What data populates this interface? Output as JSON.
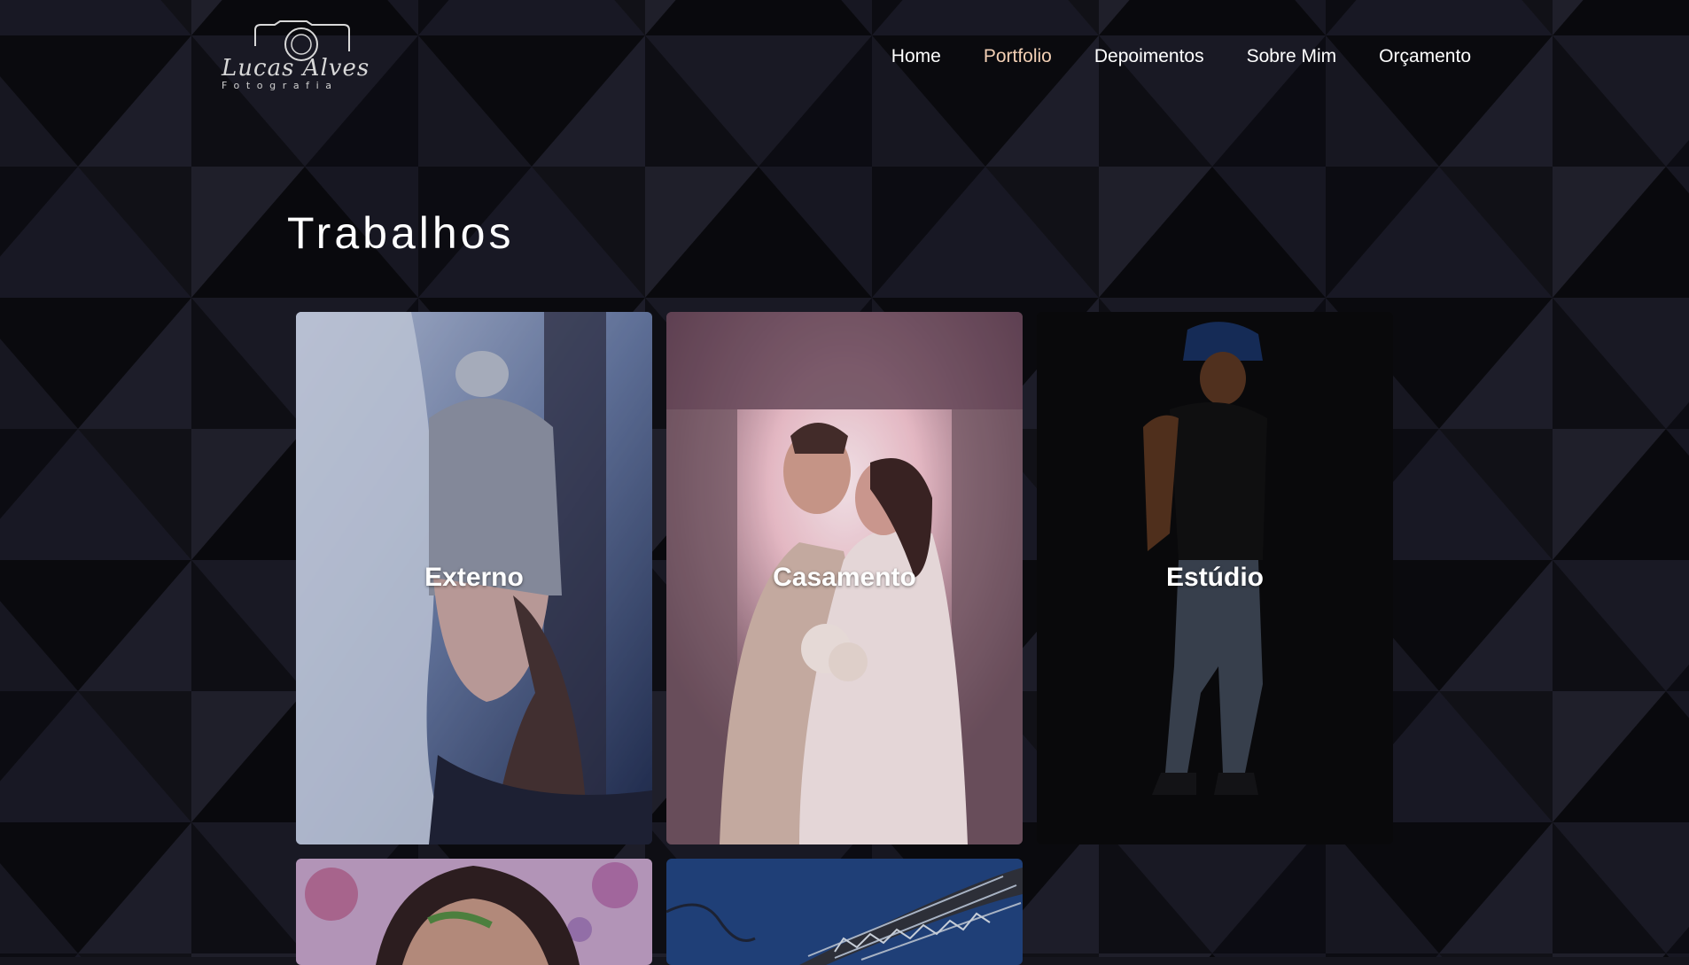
{
  "brand": {
    "logo_script": "Lucas Alves",
    "logo_sub": "Fotografia"
  },
  "nav": {
    "items": [
      {
        "label": "Home",
        "active": false
      },
      {
        "label": "Portfolio",
        "active": true
      },
      {
        "label": "Depoimentos",
        "active": false
      },
      {
        "label": "Sobre Mim",
        "active": false
      },
      {
        "label": "Orçamento",
        "active": false
      }
    ]
  },
  "section": {
    "title": "Trabalhos"
  },
  "portfolio": {
    "cards": [
      {
        "label": "Externo",
        "icon": "winter-portrait-photo"
      },
      {
        "label": "Casamento",
        "icon": "wedding-couple-photo"
      },
      {
        "label": "Estúdio",
        "icon": "studio-model-photo"
      },
      {
        "label": "",
        "icon": "artistic-portrait-photo"
      },
      {
        "label": "",
        "icon": "bridge-photo"
      }
    ]
  },
  "colors": {
    "background": "#15151d",
    "active_nav": "#f2cfb4",
    "text": "#ffffff"
  }
}
